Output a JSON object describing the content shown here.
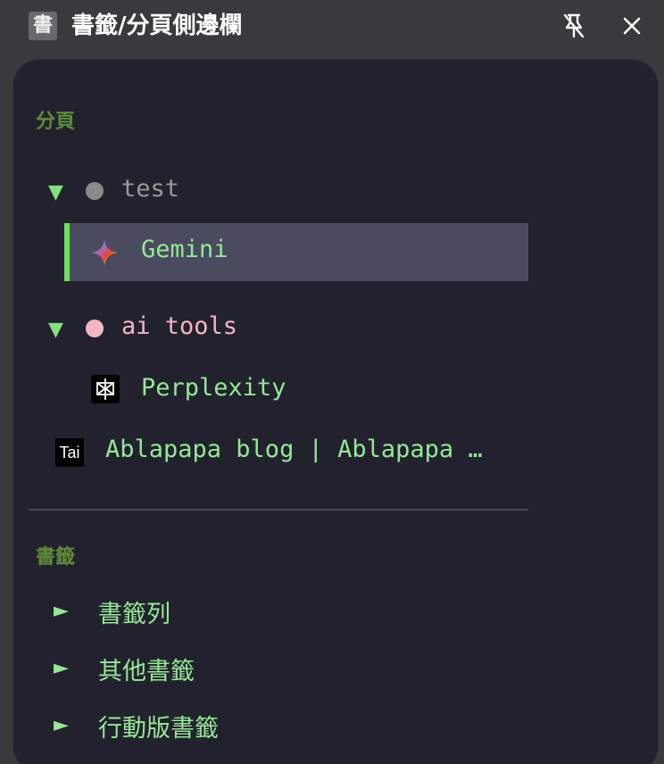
{
  "window": {
    "app_icon_char": "書",
    "title": "書籤/分頁側邊欄",
    "unpin_icon": "unpin-icon",
    "close_icon": "close-icon"
  },
  "tabs_section": {
    "title": "分頁",
    "groups": [
      {
        "name": "test",
        "collapsed_indicator": "▼",
        "dot_color": "#8a8a8a",
        "label_color": "#9a9a9a",
        "tabs": [
          {
            "label": "Gemini",
            "icon": "gemini-icon",
            "active": true
          }
        ]
      },
      {
        "name": "ai tools",
        "collapsed_indicator": "▼",
        "dot_color": "#f4b6c2",
        "label_color": "#f4b6c2",
        "tabs": [
          {
            "label": "Perplexity",
            "icon": "perplexity-icon",
            "active": false
          }
        ]
      }
    ],
    "ungrouped_tabs": [
      {
        "label": "Ablapapa blog | Ablapapa …",
        "favicon_text": "Tai",
        "icon": "tai-favicon-icon"
      }
    ]
  },
  "bookmarks_section": {
    "title": "書籤",
    "folders": [
      {
        "label": "書籤列",
        "indicator": "►"
      },
      {
        "label": "其他書籤",
        "indicator": "►"
      },
      {
        "label": "行動版書籤",
        "indicator": "►"
      }
    ]
  },
  "colors": {
    "accent_green": "#69e35a",
    "text_green": "#96e896",
    "section_title_green": "#5f8c3a",
    "panel_bg": "#22222e",
    "active_row_bg": "#4a4b5f"
  }
}
